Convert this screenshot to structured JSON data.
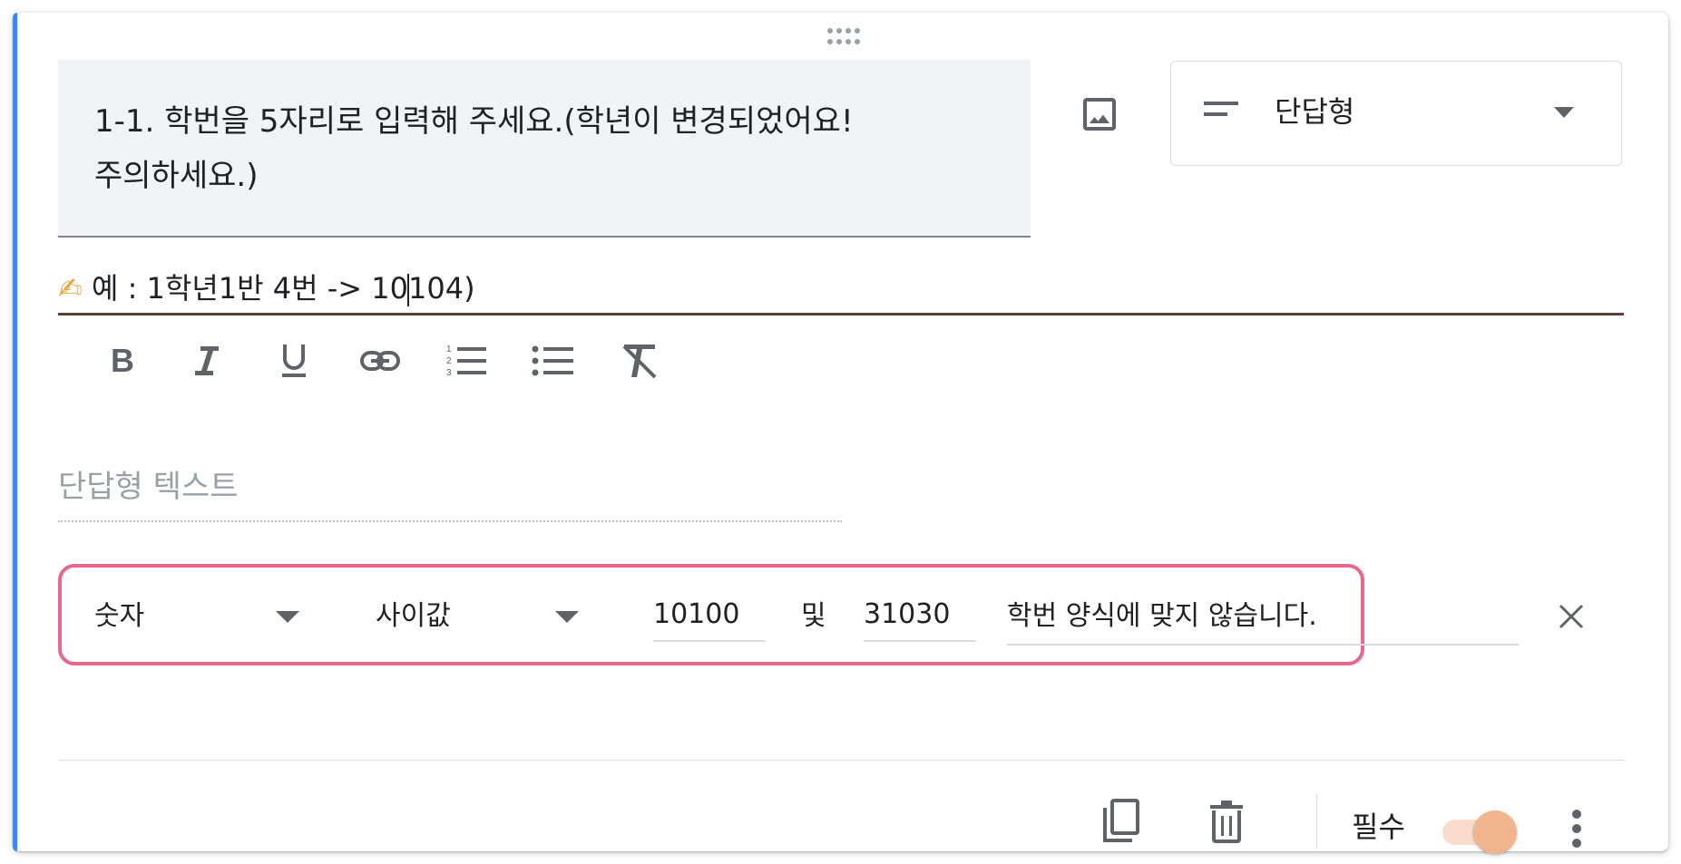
{
  "question": {
    "title_line1": "1-1. 학번을 5자리로 입력해 주세요.(학년이 변경되었어요!",
    "title_line2": "주의하세요.)",
    "type_label": "단답형"
  },
  "description": {
    "emoji": "✍",
    "text_before_caret": "예 : 1학년1반 4번 -> 10",
    "text_after_caret": "104)"
  },
  "answer": {
    "placeholder": "단답형 텍스트"
  },
  "validation": {
    "type_label": "숫자",
    "condition_label": "사이값",
    "min_value": "10100",
    "and_label": "및",
    "max_value": "31030",
    "error_text": "학번 양식에 맞지 않습니다."
  },
  "footer": {
    "required_label": "필수",
    "required_on": true
  },
  "colors": {
    "accent_bar": "#4285f4",
    "highlight_border": "#e8678a",
    "description_underline": "#5d4037",
    "toggle_thumb": "#f0b48e",
    "toggle_track": "#f8dccd"
  },
  "icons": {
    "drag": "drag-handle-icon",
    "image": "image-icon",
    "short_answer": "short-answer-icon",
    "dropdown": "caret-down-icon",
    "bold": "bold-icon",
    "italic": "italic-icon",
    "underline": "underline-icon",
    "link": "link-icon",
    "numbered_list": "numbered-list-icon",
    "bulleted_list": "bulleted-list-icon",
    "clear_format": "clear-format-icon",
    "close": "close-icon",
    "duplicate": "duplicate-icon",
    "delete": "trash-icon",
    "more": "more-vert-icon"
  }
}
